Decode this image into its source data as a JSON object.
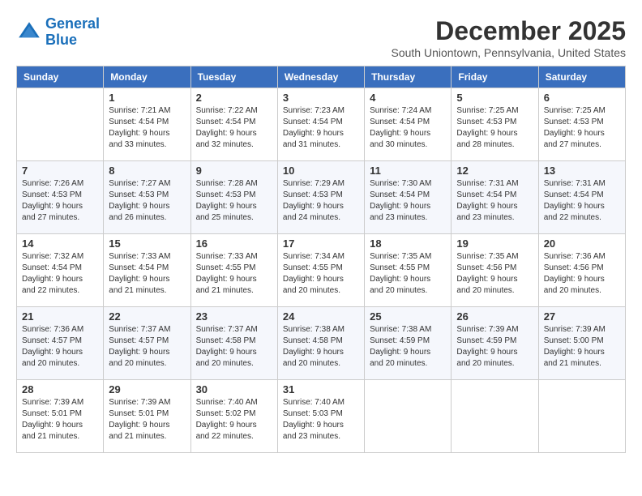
{
  "logo": {
    "line1": "General",
    "line2": "Blue"
  },
  "header": {
    "title": "December 2025",
    "subtitle": "South Uniontown, Pennsylvania, United States"
  },
  "weekdays": [
    "Sunday",
    "Monday",
    "Tuesday",
    "Wednesday",
    "Thursday",
    "Friday",
    "Saturday"
  ],
  "weeks": [
    [
      {
        "day": "",
        "sunrise": "",
        "sunset": "",
        "daylight": ""
      },
      {
        "day": "1",
        "sunrise": "Sunrise: 7:21 AM",
        "sunset": "Sunset: 4:54 PM",
        "daylight": "Daylight: 9 hours and 33 minutes."
      },
      {
        "day": "2",
        "sunrise": "Sunrise: 7:22 AM",
        "sunset": "Sunset: 4:54 PM",
        "daylight": "Daylight: 9 hours and 32 minutes."
      },
      {
        "day": "3",
        "sunrise": "Sunrise: 7:23 AM",
        "sunset": "Sunset: 4:54 PM",
        "daylight": "Daylight: 9 hours and 31 minutes."
      },
      {
        "day": "4",
        "sunrise": "Sunrise: 7:24 AM",
        "sunset": "Sunset: 4:54 PM",
        "daylight": "Daylight: 9 hours and 30 minutes."
      },
      {
        "day": "5",
        "sunrise": "Sunrise: 7:25 AM",
        "sunset": "Sunset: 4:53 PM",
        "daylight": "Daylight: 9 hours and 28 minutes."
      },
      {
        "day": "6",
        "sunrise": "Sunrise: 7:25 AM",
        "sunset": "Sunset: 4:53 PM",
        "daylight": "Daylight: 9 hours and 27 minutes."
      }
    ],
    [
      {
        "day": "7",
        "sunrise": "Sunrise: 7:26 AM",
        "sunset": "Sunset: 4:53 PM",
        "daylight": "Daylight: 9 hours and 27 minutes."
      },
      {
        "day": "8",
        "sunrise": "Sunrise: 7:27 AM",
        "sunset": "Sunset: 4:53 PM",
        "daylight": "Daylight: 9 hours and 26 minutes."
      },
      {
        "day": "9",
        "sunrise": "Sunrise: 7:28 AM",
        "sunset": "Sunset: 4:53 PM",
        "daylight": "Daylight: 9 hours and 25 minutes."
      },
      {
        "day": "10",
        "sunrise": "Sunrise: 7:29 AM",
        "sunset": "Sunset: 4:53 PM",
        "daylight": "Daylight: 9 hours and 24 minutes."
      },
      {
        "day": "11",
        "sunrise": "Sunrise: 7:30 AM",
        "sunset": "Sunset: 4:54 PM",
        "daylight": "Daylight: 9 hours and 23 minutes."
      },
      {
        "day": "12",
        "sunrise": "Sunrise: 7:31 AM",
        "sunset": "Sunset: 4:54 PM",
        "daylight": "Daylight: 9 hours and 23 minutes."
      },
      {
        "day": "13",
        "sunrise": "Sunrise: 7:31 AM",
        "sunset": "Sunset: 4:54 PM",
        "daylight": "Daylight: 9 hours and 22 minutes."
      }
    ],
    [
      {
        "day": "14",
        "sunrise": "Sunrise: 7:32 AM",
        "sunset": "Sunset: 4:54 PM",
        "daylight": "Daylight: 9 hours and 22 minutes."
      },
      {
        "day": "15",
        "sunrise": "Sunrise: 7:33 AM",
        "sunset": "Sunset: 4:54 PM",
        "daylight": "Daylight: 9 hours and 21 minutes."
      },
      {
        "day": "16",
        "sunrise": "Sunrise: 7:33 AM",
        "sunset": "Sunset: 4:55 PM",
        "daylight": "Daylight: 9 hours and 21 minutes."
      },
      {
        "day": "17",
        "sunrise": "Sunrise: 7:34 AM",
        "sunset": "Sunset: 4:55 PM",
        "daylight": "Daylight: 9 hours and 20 minutes."
      },
      {
        "day": "18",
        "sunrise": "Sunrise: 7:35 AM",
        "sunset": "Sunset: 4:55 PM",
        "daylight": "Daylight: 9 hours and 20 minutes."
      },
      {
        "day": "19",
        "sunrise": "Sunrise: 7:35 AM",
        "sunset": "Sunset: 4:56 PM",
        "daylight": "Daylight: 9 hours and 20 minutes."
      },
      {
        "day": "20",
        "sunrise": "Sunrise: 7:36 AM",
        "sunset": "Sunset: 4:56 PM",
        "daylight": "Daylight: 9 hours and 20 minutes."
      }
    ],
    [
      {
        "day": "21",
        "sunrise": "Sunrise: 7:36 AM",
        "sunset": "Sunset: 4:57 PM",
        "daylight": "Daylight: 9 hours and 20 minutes."
      },
      {
        "day": "22",
        "sunrise": "Sunrise: 7:37 AM",
        "sunset": "Sunset: 4:57 PM",
        "daylight": "Daylight: 9 hours and 20 minutes."
      },
      {
        "day": "23",
        "sunrise": "Sunrise: 7:37 AM",
        "sunset": "Sunset: 4:58 PM",
        "daylight": "Daylight: 9 hours and 20 minutes."
      },
      {
        "day": "24",
        "sunrise": "Sunrise: 7:38 AM",
        "sunset": "Sunset: 4:58 PM",
        "daylight": "Daylight: 9 hours and 20 minutes."
      },
      {
        "day": "25",
        "sunrise": "Sunrise: 7:38 AM",
        "sunset": "Sunset: 4:59 PM",
        "daylight": "Daylight: 9 hours and 20 minutes."
      },
      {
        "day": "26",
        "sunrise": "Sunrise: 7:39 AM",
        "sunset": "Sunset: 4:59 PM",
        "daylight": "Daylight: 9 hours and 20 minutes."
      },
      {
        "day": "27",
        "sunrise": "Sunrise: 7:39 AM",
        "sunset": "Sunset: 5:00 PM",
        "daylight": "Daylight: 9 hours and 21 minutes."
      }
    ],
    [
      {
        "day": "28",
        "sunrise": "Sunrise: 7:39 AM",
        "sunset": "Sunset: 5:01 PM",
        "daylight": "Daylight: 9 hours and 21 minutes."
      },
      {
        "day": "29",
        "sunrise": "Sunrise: 7:39 AM",
        "sunset": "Sunset: 5:01 PM",
        "daylight": "Daylight: 9 hours and 21 minutes."
      },
      {
        "day": "30",
        "sunrise": "Sunrise: 7:40 AM",
        "sunset": "Sunset: 5:02 PM",
        "daylight": "Daylight: 9 hours and 22 minutes."
      },
      {
        "day": "31",
        "sunrise": "Sunrise: 7:40 AM",
        "sunset": "Sunset: 5:03 PM",
        "daylight": "Daylight: 9 hours and 23 minutes."
      },
      {
        "day": "",
        "sunrise": "",
        "sunset": "",
        "daylight": ""
      },
      {
        "day": "",
        "sunrise": "",
        "sunset": "",
        "daylight": ""
      },
      {
        "day": "",
        "sunrise": "",
        "sunset": "",
        "daylight": ""
      }
    ]
  ]
}
